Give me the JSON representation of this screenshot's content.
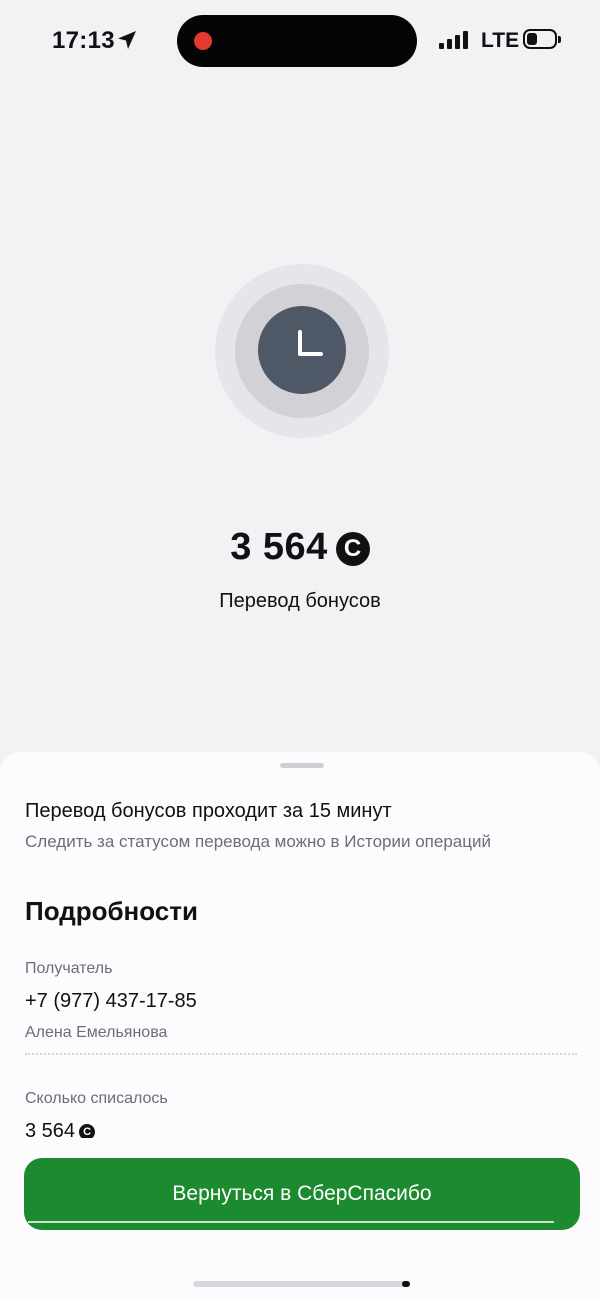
{
  "status_bar": {
    "time": "17:13",
    "network": "LTE",
    "icons": [
      "location-arrow-icon",
      "recording-indicator-icon",
      "cellular-signal-icon",
      "battery-low-icon"
    ]
  },
  "hero": {
    "icon": "clock-icon",
    "amount": "3 564",
    "currency_icon": "sberspasibo-coin-icon",
    "currency_symbol": "С",
    "title": "Перевод бонусов"
  },
  "info": {
    "title": "Перевод бонусов проходит за 15 минут",
    "subtitle": "Следить за статусом перевода можно в Истории операций"
  },
  "details": {
    "heading": "Подробности",
    "recipient_label": "Получатель",
    "recipient_phone": "+7 (977) 437-17-85",
    "recipient_name": "Алена Емельянова",
    "debited_label": "Сколько списалось",
    "debited_value": "3 564"
  },
  "actions": {
    "return_button": "Вернуться в СберСпасибо"
  },
  "colors": {
    "accent_green": "#1c8a2f",
    "clock_dark": "#4f5867",
    "recording_red": "#e23a2f"
  }
}
